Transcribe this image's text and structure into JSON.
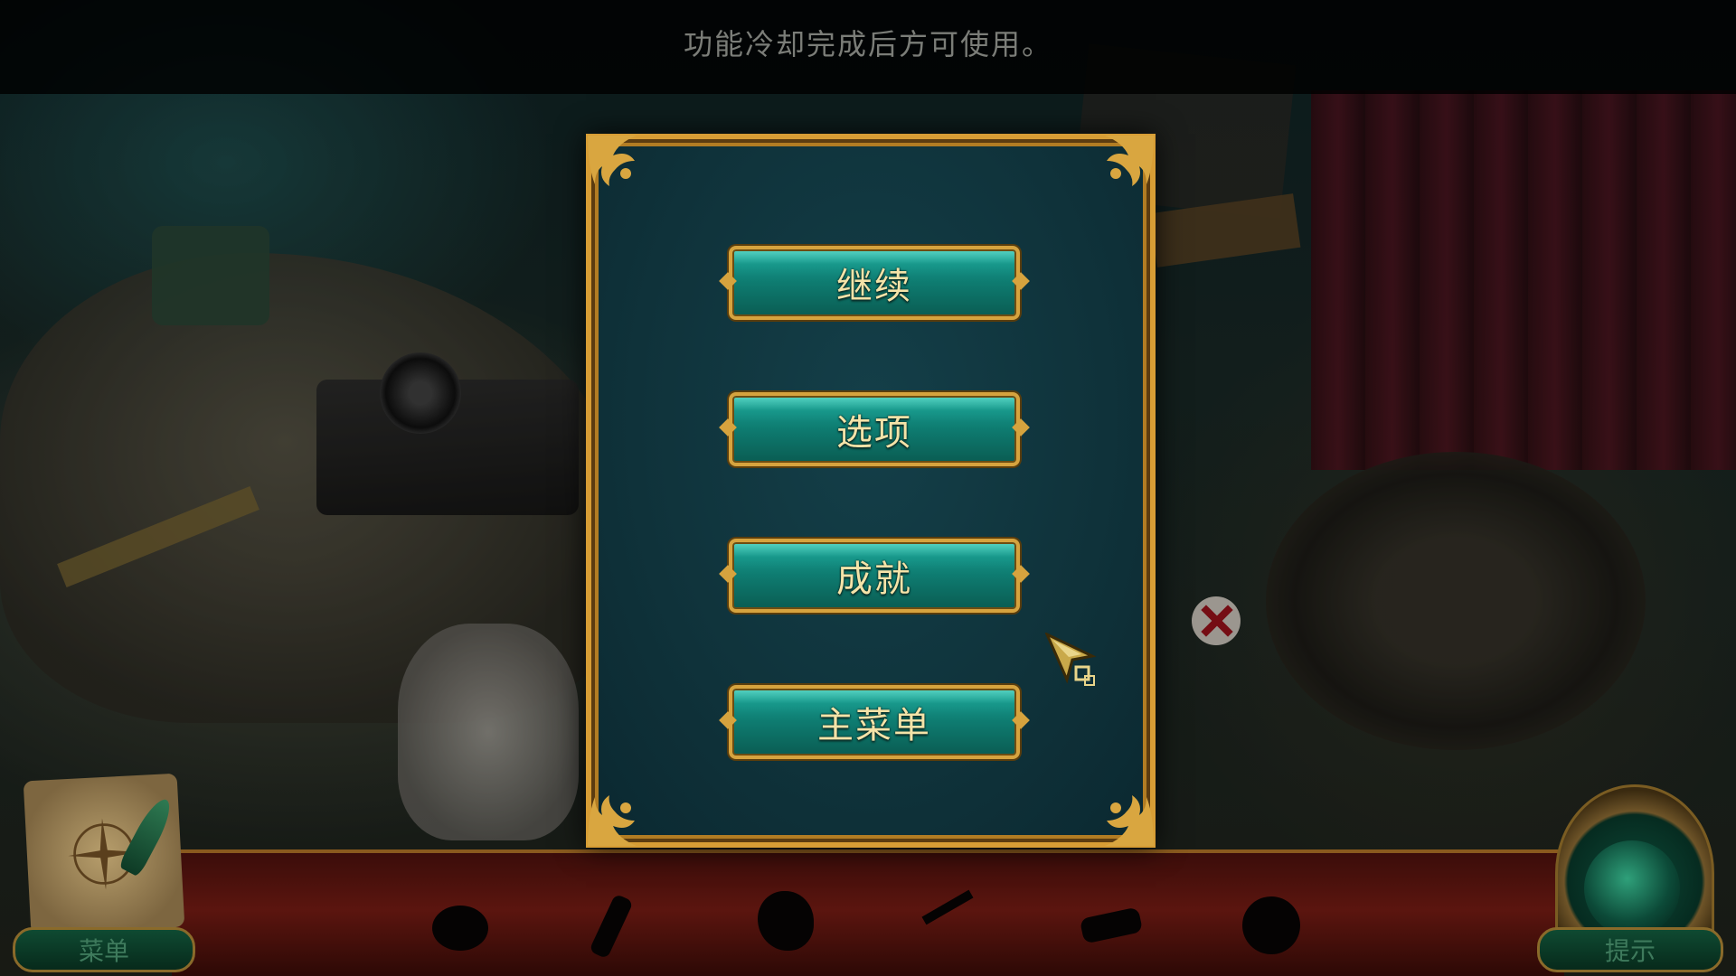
{
  "notice": {
    "text": "功能冷却完成后方可使用。"
  },
  "pause_dialog": {
    "buttons": [
      {
        "label": "继续"
      },
      {
        "label": "选项"
      },
      {
        "label": "成就"
      },
      {
        "label": "主菜单"
      }
    ]
  },
  "hud": {
    "menu_label": "菜单",
    "hint_label": "提示"
  },
  "inventory": {
    "slots": [
      {
        "icon": "silhouette-oval"
      },
      {
        "icon": "silhouette-stick"
      },
      {
        "icon": "silhouette-blob"
      },
      {
        "icon": "silhouette-crank"
      },
      {
        "icon": "silhouette-cylinder"
      },
      {
        "icon": "silhouette-round"
      }
    ]
  },
  "colors": {
    "frame_gold": "#d79d35",
    "button_teal": "#1aa396",
    "label_cream": "#f4e3a8",
    "inventory_red": "#5b150f"
  }
}
